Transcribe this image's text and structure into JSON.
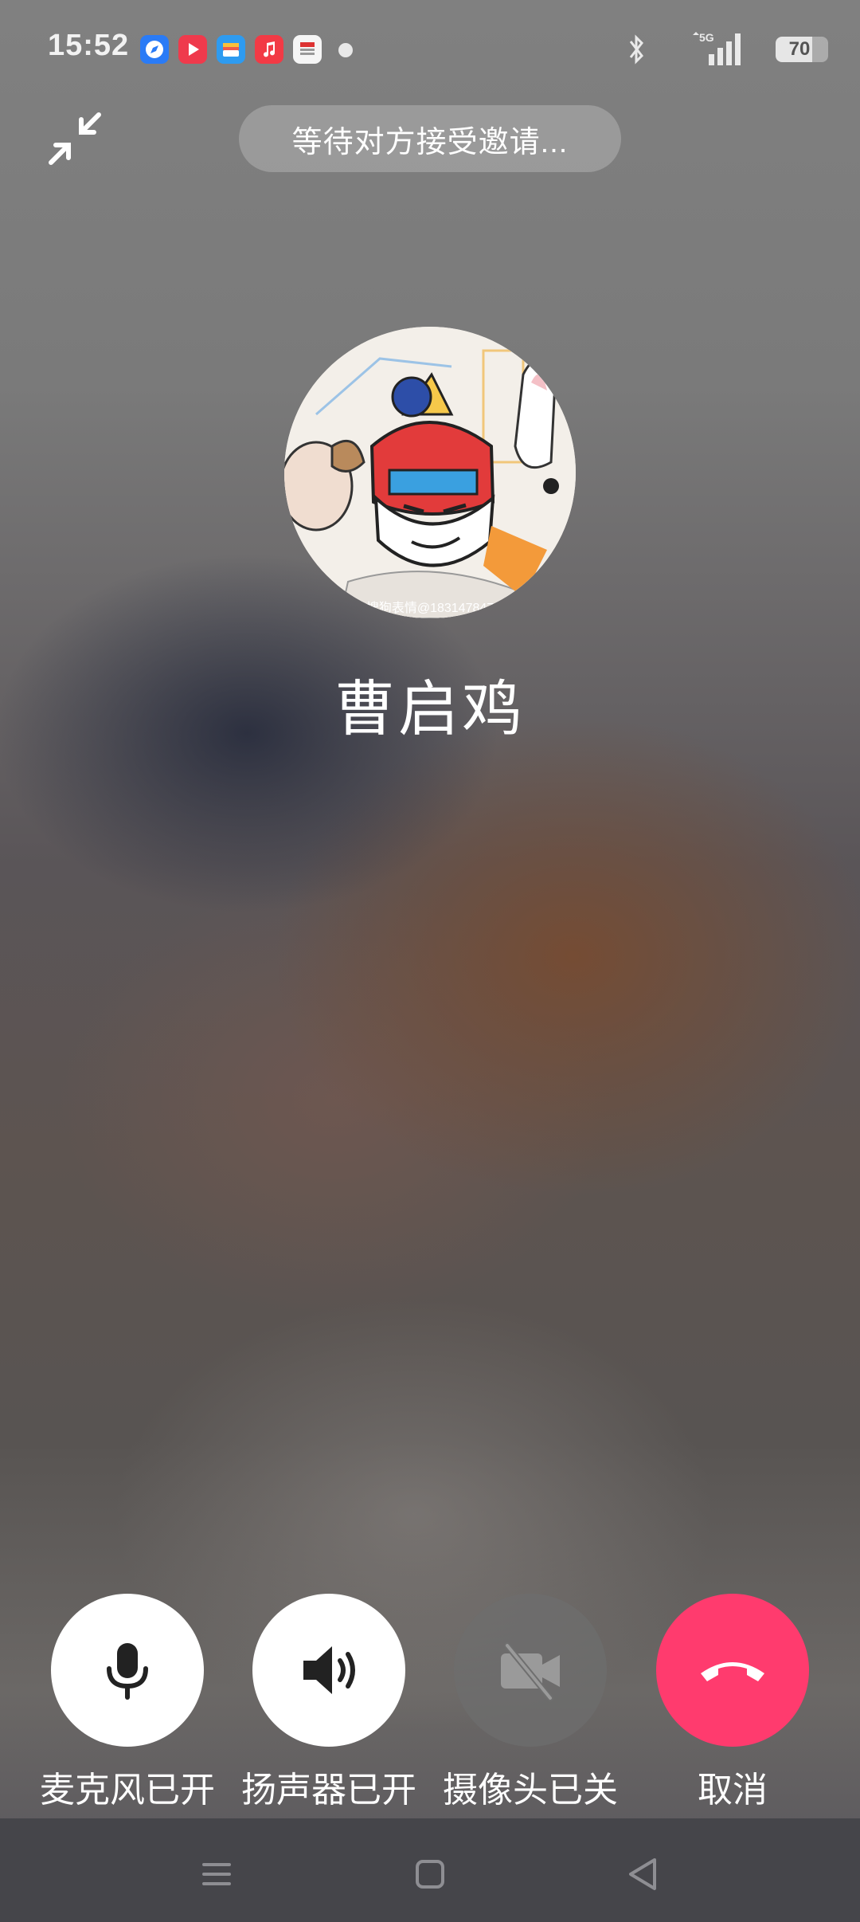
{
  "status_bar": {
    "time": "15:52",
    "app_icons": [
      {
        "name": "browser-app-icon",
        "color": "#2a7bf6"
      },
      {
        "name": "video-app-icon",
        "color": "#ef3a4c"
      },
      {
        "name": "wallet-app-icon",
        "color": "#2e9bf0"
      },
      {
        "name": "music-app-icon",
        "color": "#f23a45"
      },
      {
        "name": "news-app-icon",
        "color": "#f5f5f5"
      }
    ],
    "network": "5G",
    "battery_level": 70,
    "battery_text": "70"
  },
  "call": {
    "status_text": "等待对方接受邀请...",
    "contact_name": "曹启鸡",
    "avatar_watermark": "搜狗表情@183147847"
  },
  "controls": [
    {
      "key": "mic",
      "label": "麦克风已开",
      "icon": "microphone-icon",
      "state": "on"
    },
    {
      "key": "speaker",
      "label": "扬声器已开",
      "icon": "speaker-icon",
      "state": "on"
    },
    {
      "key": "camera",
      "label": "摄像头已关",
      "icon": "camera-off-icon",
      "state": "off"
    },
    {
      "key": "cancel",
      "label": "取消",
      "icon": "hang-up-icon",
      "state": "action"
    }
  ],
  "colors": {
    "cancel_red": "#ff3b6e",
    "control_white": "#ffffff",
    "control_disabled": "#6e6e6e"
  }
}
